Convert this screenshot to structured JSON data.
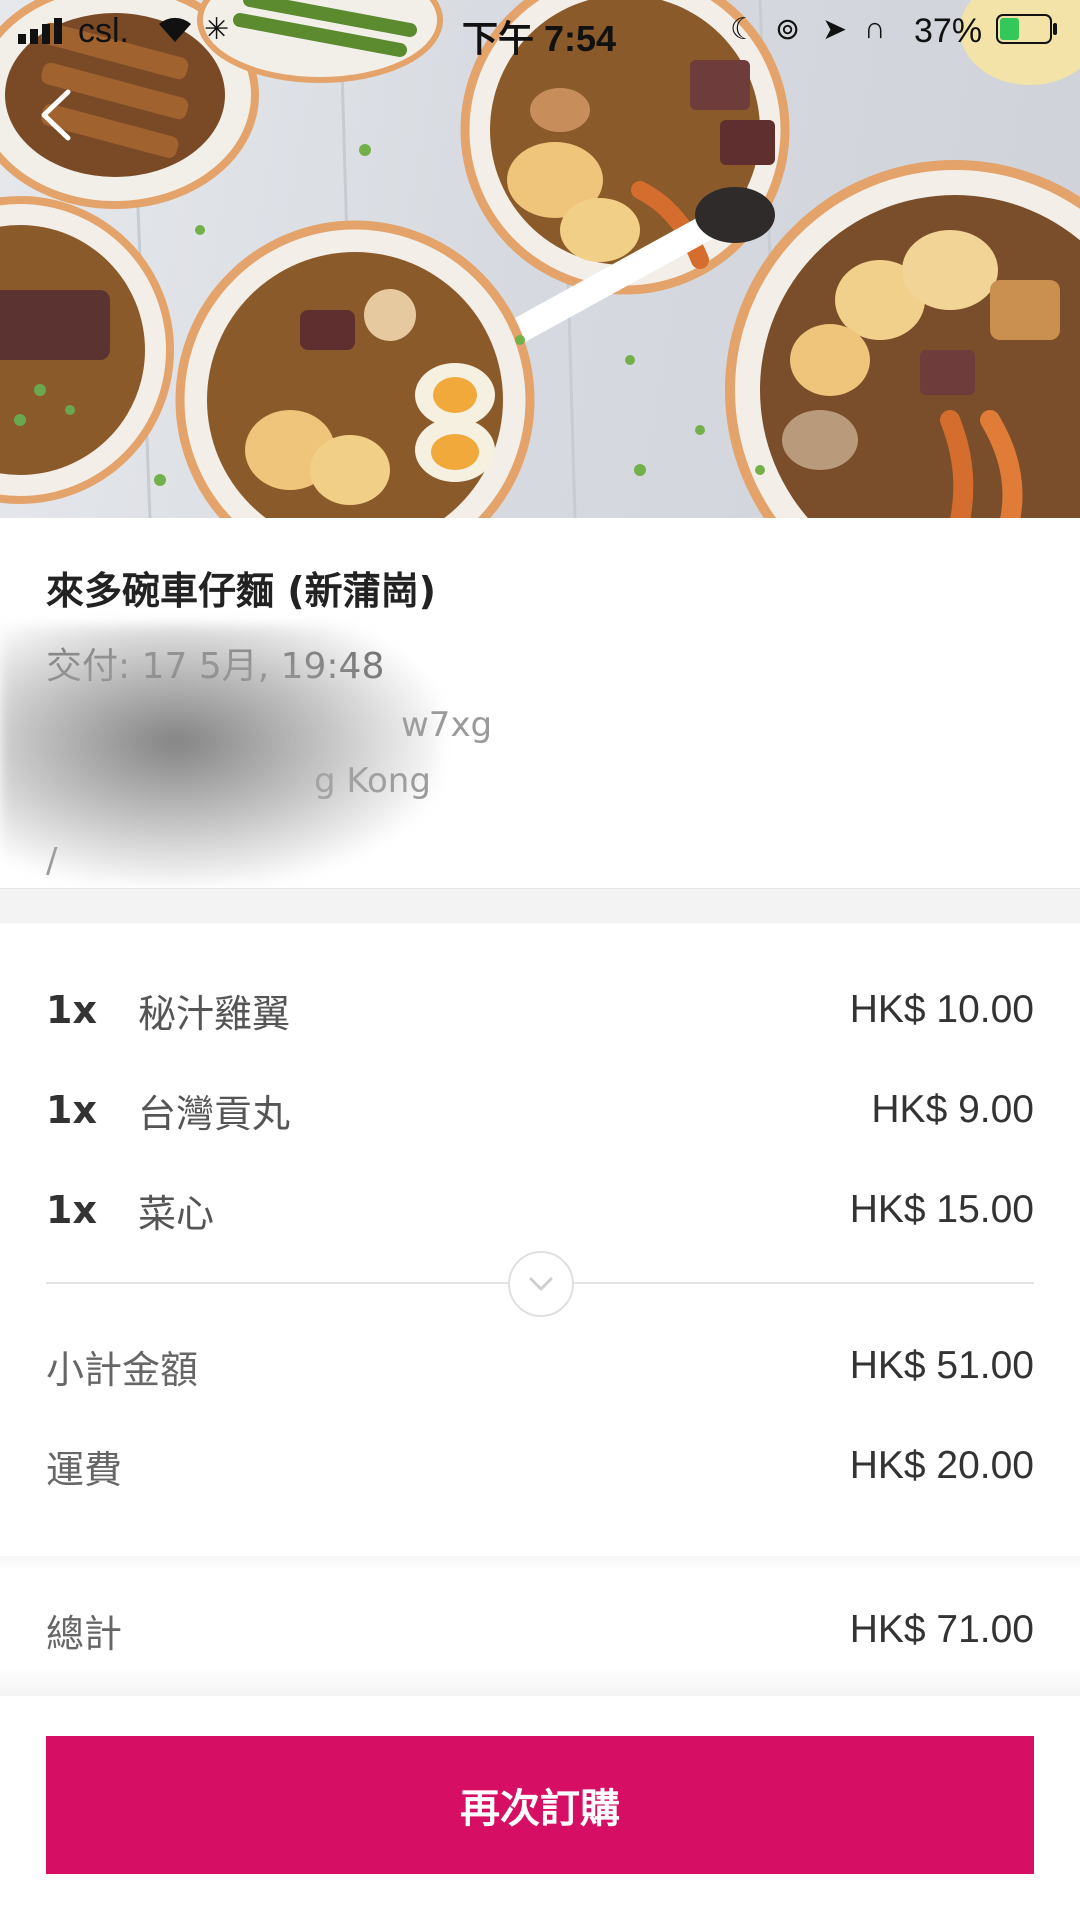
{
  "status_bar": {
    "carrier": "csl.",
    "time": "下午 7:54",
    "battery": "37%"
  },
  "hero": {
    "icons": [
      "back-icon",
      "signal-icon",
      "wifi-icon",
      "moon-icon",
      "rotation-lock-icon",
      "location-icon",
      "headphones-icon",
      "battery-icon"
    ]
  },
  "restaurant": {
    "name": "來多碗車仔麵 (新蒲崗)",
    "delivery": "交付: 17 5月, 19:48",
    "address_line1": "w7xg",
    "address_line2": "g Kong",
    "address_line3": "/"
  },
  "items": [
    {
      "qty": "1x",
      "name": "秘汁雞翼",
      "price": "HK$ 10.00"
    },
    {
      "qty": "1x",
      "name": "台灣貢丸",
      "price": "HK$ 9.00"
    },
    {
      "qty": "1x",
      "name": "菜心",
      "price": "HK$ 15.00"
    }
  ],
  "summary": {
    "subtotal_label": "小計金額",
    "subtotal": "HK$ 51.00",
    "delivery_label": "運費",
    "delivery_fee": "HK$ 20.00",
    "total_label": "總計",
    "total": "HK$ 71.00"
  },
  "actions": {
    "reorder_label": "再次訂購"
  },
  "colors": {
    "brand": "#d70f64",
    "text_primary": "#333333",
    "text_secondary": "#666666"
  }
}
